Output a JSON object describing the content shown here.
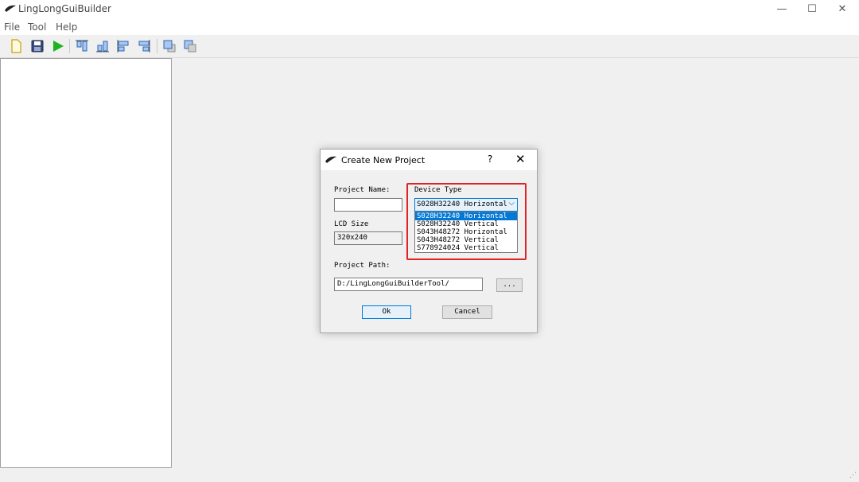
{
  "app": {
    "title": "LingLongGuiBuilder"
  },
  "window_controls": {
    "minimize": "—",
    "maximize": "☐",
    "close": "✕"
  },
  "menu": [
    "File",
    "Tool",
    "Help"
  ],
  "toolbar_icons": [
    "new-file-icon",
    "save-icon",
    "run-icon",
    "align-top-icon",
    "align-bottom-icon",
    "align-left-icon",
    "align-right-icon",
    "bring-front-icon",
    "send-back-icon"
  ],
  "dialog": {
    "title": "Create New Project",
    "help": "?",
    "close": "✕",
    "project_name_label": "Project Name:",
    "project_name_value": "",
    "device_type_label": "Device Type",
    "device_type_selected": "S028H32240 Horizontal",
    "device_type_options": [
      "S028H32240 Horizontal",
      "S028H32240 Vertical",
      "S043H48272 Horizontal",
      "S043H48272 Vertical",
      "S778924024 Vertical"
    ],
    "lcd_size_label": "LCD Size",
    "lcd_size_value": "320x240",
    "project_path_label": "Project Path:",
    "project_path_value": "D:/LingLongGuiBuilderTool/",
    "browse_label": "...",
    "ok_label": "Ok",
    "cancel_label": "Cancel"
  },
  "colors": {
    "accent": "#0078d7",
    "highlight": "#e02424",
    "run_green": "#1fb31f"
  }
}
